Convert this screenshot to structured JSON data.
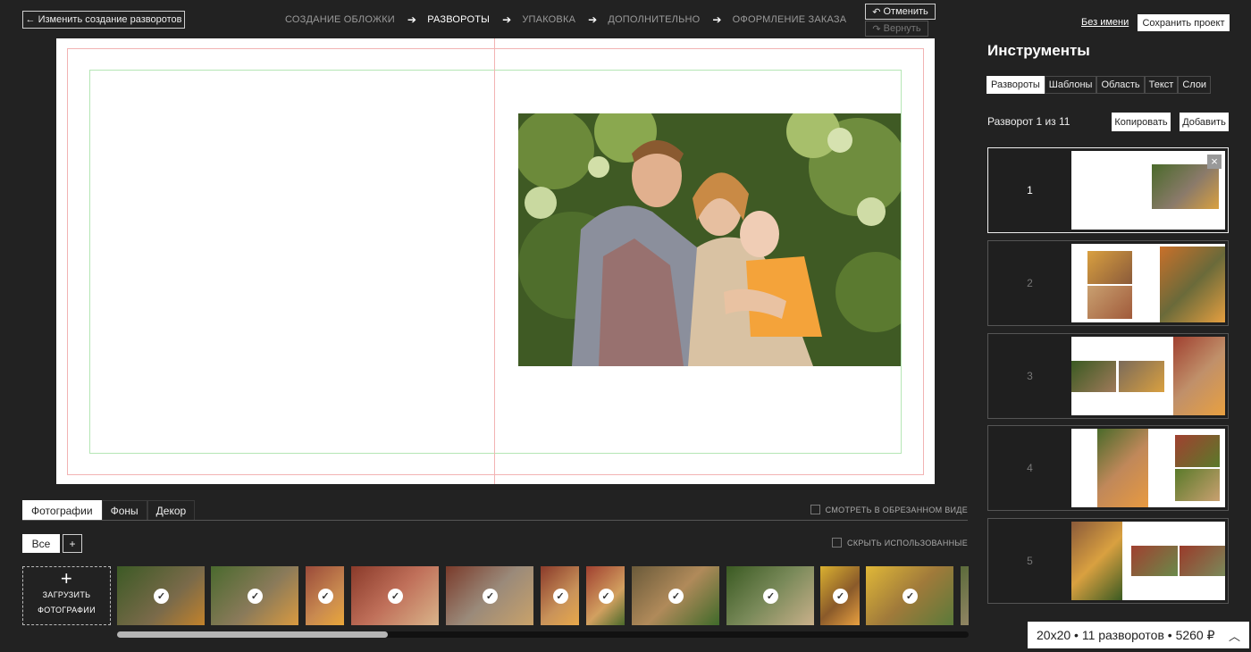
{
  "header": {
    "back_label": "← Изменить создание разворотов",
    "steps": [
      {
        "label": "СОЗДАНИЕ ОБЛОЖКИ",
        "active": false
      },
      {
        "label": "РАЗВОРОТЫ",
        "active": true
      },
      {
        "label": "УПАКОВКА",
        "active": false
      },
      {
        "label": "ДОПОЛНИТЕЛЬНО",
        "active": false
      },
      {
        "label": "ОФОРМЛЕНИЕ ЗАКАЗА",
        "active": false
      }
    ],
    "undo_label": "Отменить",
    "redo_label": "Вернуть",
    "project_name": "Без имени",
    "save_label": "Сохранить проект"
  },
  "bottom_panel": {
    "tabs": [
      "Фотографии",
      "Фоны",
      "Декор"
    ],
    "active_tab": "Фотографии",
    "crop_view_label": "СМОТРЕТЬ В ОБРЕЗАННОМ ВИДЕ",
    "filter_all": "Все",
    "filter_add": "+",
    "hide_used_label": "СКРЫТЬ ИСПОЛЬЗОВАННЫЕ",
    "upload_line1": "ЗАГРУЗИТЬ",
    "upload_line2": "ФОТОГРАФИИ",
    "photos_used_count": 11
  },
  "tools": {
    "title": "Инструменты",
    "tabs": [
      "Развороты",
      "Шаблоны",
      "Область",
      "Текст",
      "Слои"
    ],
    "active_tab": "Развороты",
    "spread_counter": "Разворот 1 из 11",
    "copy_label": "Копировать",
    "add_label": "Добавить",
    "spreads": [
      "1",
      "2",
      "3",
      "4",
      "5"
    ],
    "active_spread": "1"
  },
  "footer": {
    "summary": "20x20 • 11 разворотов • 5260 ₽"
  },
  "colors": {
    "background": "#222222",
    "bleed_line": "#f2b3b3",
    "safe_line": "#b5e6b5"
  }
}
